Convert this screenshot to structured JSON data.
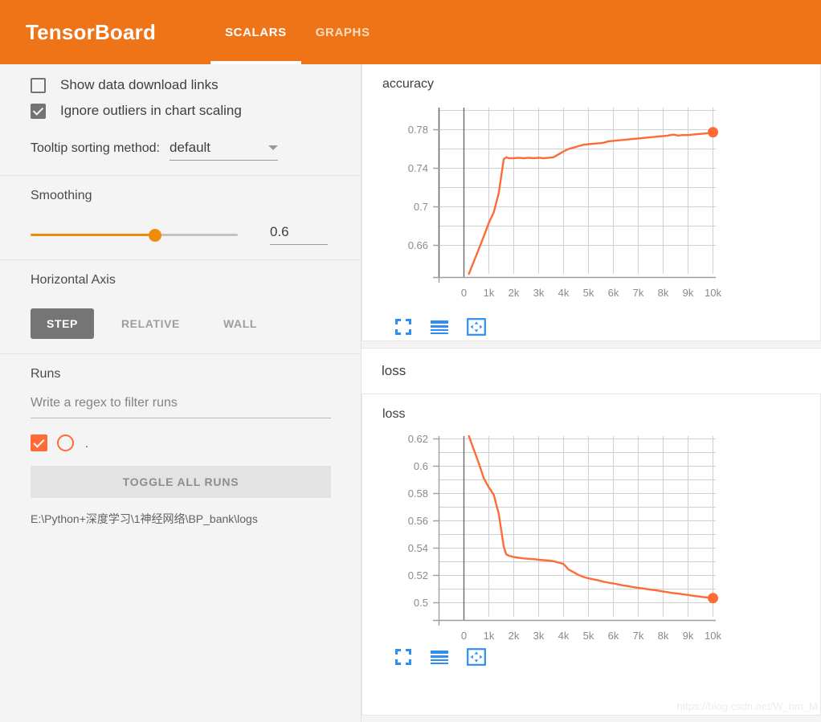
{
  "header": {
    "brand": "TensorBoard",
    "tabs": [
      {
        "label": "SCALARS",
        "active": true
      },
      {
        "label": "GRAPHS",
        "active": false
      }
    ]
  },
  "sidebar": {
    "checkboxes": [
      {
        "label": "Show data download links",
        "checked": false
      },
      {
        "label": "Ignore outliers in chart scaling",
        "checked": true
      }
    ],
    "tooltip_sorting": {
      "label": "Tooltip sorting method:",
      "value": "default"
    },
    "smoothing": {
      "title": "Smoothing",
      "value": "0.6",
      "percent": 60
    },
    "horizontal_axis": {
      "title": "Horizontal Axis",
      "options": [
        {
          "label": "STEP",
          "active": true
        },
        {
          "label": "RELATIVE",
          "active": false
        },
        {
          "label": "WALL",
          "active": false
        }
      ]
    },
    "runs": {
      "title": "Runs",
      "filter_placeholder": "Write a regex to filter runs",
      "filter_value": "",
      "run_label": ".",
      "toggle_all_label": "TOGGLE ALL RUNS",
      "logdir": "E:\\Python+深度学习\\1神经网络\\BP_bank\\logs"
    }
  },
  "main": {
    "group_title": "loss",
    "chart_icons": [
      {
        "name": "expand-icon"
      },
      {
        "name": "data-table-icon"
      },
      {
        "name": "fit-domain-icon"
      }
    ],
    "watermark": "https://blog.csdn.net/W_hm_M"
  },
  "colors": {
    "brand_orange": "#ef7418",
    "series_orange": "#ff6b35",
    "slider_orange": "#ef8c0a",
    "icon_blue": "#2f8ef4",
    "active_button_gray": "#757575"
  },
  "chart_data": [
    {
      "type": "line",
      "title": "accuracy",
      "xlabel": "",
      "ylabel": "",
      "xlim": [
        -600,
        10600
      ],
      "ylim": [
        0.638,
        0.798
      ],
      "xticks": [
        0,
        1000,
        2000,
        3000,
        4000,
        5000,
        6000,
        7000,
        8000,
        9000,
        10000
      ],
      "xticklabels": [
        "0",
        "1k",
        "2k",
        "3k",
        "4k",
        "5k",
        "6k",
        "7k",
        "8k",
        "9k",
        "10k"
      ],
      "yticks": [
        0.66,
        0.7,
        0.74,
        0.78
      ],
      "yticklabels": [
        "0.66",
        "0.7",
        "0.74",
        "0.78"
      ],
      "yminor": [
        0.68,
        0.72,
        0.76
      ],
      "grid": true,
      "legend": false,
      "end_marker": {
        "x": 10000,
        "y": 0.785
      },
      "series": [
        {
          "name": ".",
          "color": "#ff6b35",
          "x": [
            200,
            400,
            600,
            800,
            1000,
            1200,
            1400,
            1600,
            1700,
            1800,
            2000,
            2200,
            2400,
            2600,
            2800,
            3000,
            3200,
            3400,
            3600,
            3800,
            4000,
            4200,
            4400,
            4600,
            4800,
            5000,
            5200,
            5400,
            5600,
            5800,
            6000,
            6200,
            6400,
            6600,
            6800,
            7000,
            7200,
            7400,
            7600,
            7800,
            8000,
            8200,
            8400,
            8600,
            8800,
            9000,
            9200,
            9400,
            9600,
            9800,
            10000
          ],
          "y": [
            0.638,
            0.651,
            0.664,
            0.677,
            0.691,
            0.702,
            0.722,
            0.757,
            0.759,
            0.758,
            0.758,
            0.7585,
            0.758,
            0.7585,
            0.758,
            0.7585,
            0.758,
            0.7585,
            0.759,
            0.762,
            0.765,
            0.7675,
            0.769,
            0.7705,
            0.772,
            0.7725,
            0.773,
            0.7735,
            0.774,
            0.7755,
            0.776,
            0.7765,
            0.777,
            0.7775,
            0.778,
            0.7785,
            0.779,
            0.7795,
            0.78,
            0.7805,
            0.781,
            0.7815,
            0.7825,
            0.7815,
            0.782,
            0.782,
            0.7825,
            0.783,
            0.7835,
            0.784,
            0.785
          ]
        }
      ]
    },
    {
      "type": "line",
      "title": "loss",
      "xlabel": "",
      "ylabel": "",
      "xlim": [
        -600,
        10600
      ],
      "ylim": [
        0.493,
        0.632
      ],
      "xticks": [
        0,
        1000,
        2000,
        3000,
        4000,
        5000,
        6000,
        7000,
        8000,
        9000,
        10000
      ],
      "xticklabels": [
        "0",
        "1k",
        "2k",
        "3k",
        "4k",
        "5k",
        "6k",
        "7k",
        "8k",
        "9k",
        "10k"
      ],
      "yticks": [
        0.5,
        0.52,
        0.54,
        0.56,
        0.58,
        0.6,
        0.62
      ],
      "yticklabels": [
        "0.5",
        "0.52",
        "0.54",
        "0.56",
        "0.58",
        "0.6",
        "0.62"
      ],
      "yminor": [
        0.51,
        0.53,
        0.55,
        0.57,
        0.59,
        0.61
      ],
      "grid": true,
      "legend": false,
      "end_marker": {
        "x": 10000,
        "y": 0.5135
      },
      "series": [
        {
          "name": ".",
          "color": "#ff6b35",
          "x": [
            200,
            400,
            600,
            800,
            1000,
            1200,
            1400,
            1500,
            1600,
            1700,
            1800,
            2000,
            2200,
            2400,
            2600,
            2800,
            3000,
            3200,
            3400,
            3600,
            3800,
            4000,
            4200,
            4400,
            4600,
            4800,
            5000,
            5200,
            5400,
            5600,
            5800,
            6000,
            6200,
            6400,
            6600,
            6800,
            7000,
            7200,
            7400,
            7600,
            7800,
            8000,
            8200,
            8400,
            8600,
            8800,
            9000,
            9200,
            9400,
            9600,
            9800,
            10000
          ],
          "y": [
            0.632,
            0.622,
            0.612,
            0.601,
            0.5945,
            0.589,
            0.575,
            0.563,
            0.551,
            0.5455,
            0.5445,
            0.5435,
            0.543,
            0.5425,
            0.5422,
            0.542,
            0.5415,
            0.5412,
            0.541,
            0.5405,
            0.5395,
            0.5385,
            0.5345,
            0.5325,
            0.5305,
            0.529,
            0.528,
            0.5272,
            0.5265,
            0.5255,
            0.5248,
            0.5242,
            0.5235,
            0.5228,
            0.5222,
            0.5215,
            0.521,
            0.5205,
            0.52,
            0.5195,
            0.519,
            0.5183,
            0.5178,
            0.5172,
            0.5168,
            0.5162,
            0.5158,
            0.5152,
            0.5148,
            0.5143,
            0.5139,
            0.5135
          ]
        }
      ]
    }
  ]
}
